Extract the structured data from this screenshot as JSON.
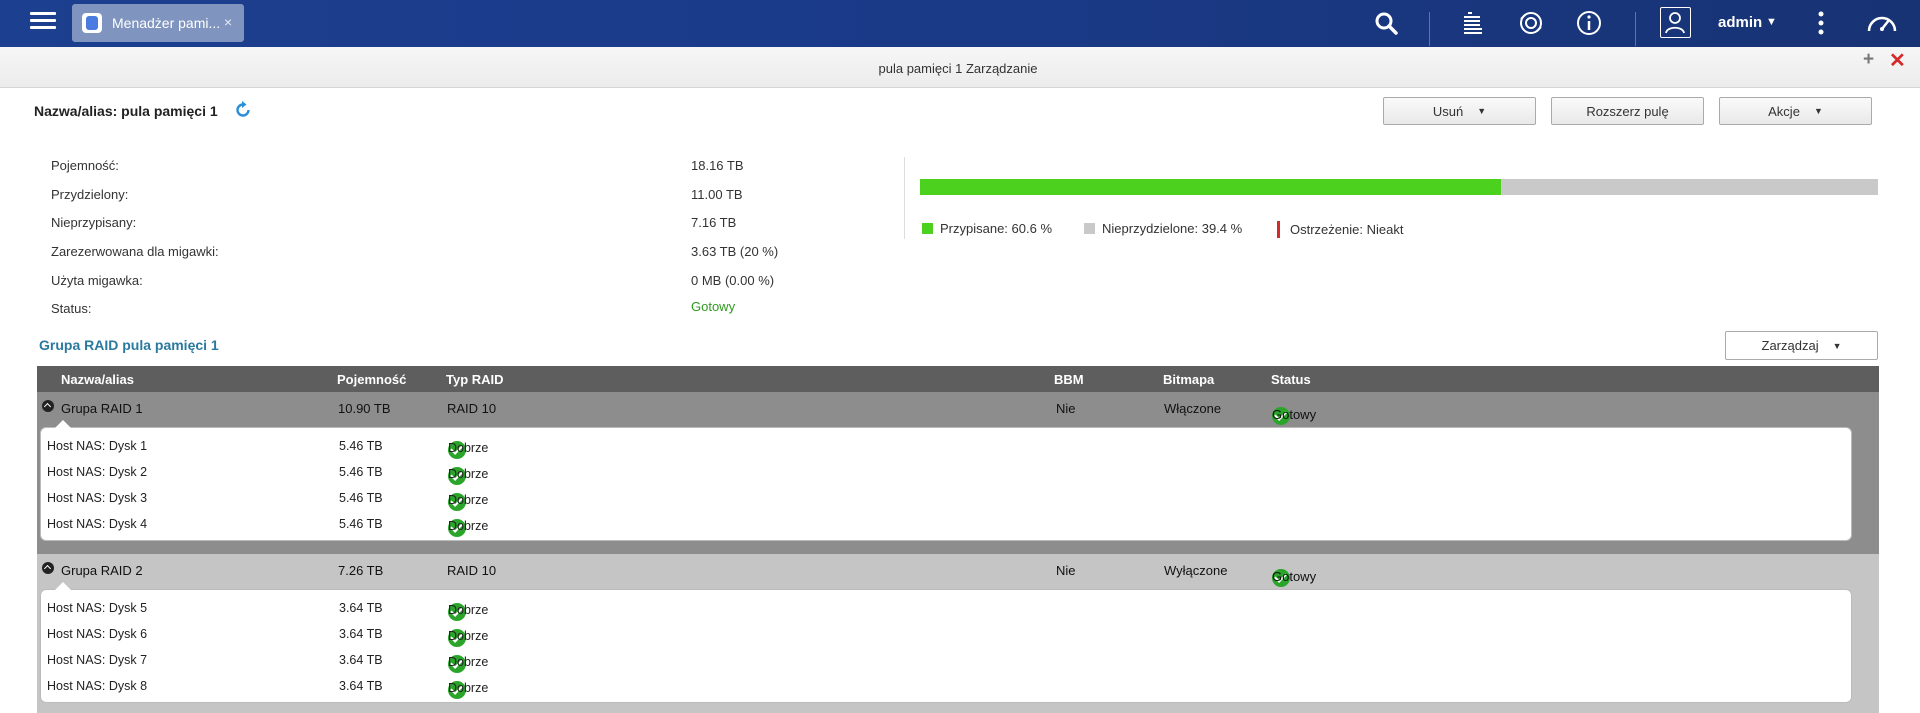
{
  "topbar": {
    "app_tab_title": "Menadżer pami...",
    "app_tab_close": "×",
    "user": "admin",
    "user_caret": "▼",
    "icons": [
      "menu-icon",
      "storage-app-icon",
      "search-icon",
      "tasks-icon",
      "sync-icon",
      "info-icon",
      "user-icon",
      "more-icon",
      "dashboard-icon"
    ]
  },
  "window": {
    "title": "pula pamięci 1 Zarządzanie",
    "plus": "+",
    "close": "✕"
  },
  "header": {
    "pool_name": "Nazwa/alias: pula pamięci 1",
    "buttons": {
      "remove": "Usuń",
      "expand": "Rozszerz pulę",
      "actions": "Akcje"
    }
  },
  "info": {
    "rows": [
      {
        "label": "Pojemność:",
        "value": "18.16 TB"
      },
      {
        "label": "Przydzielony:",
        "value": "11.00 TB"
      },
      {
        "label": "Nieprzypisany:",
        "value": "7.16 TB"
      },
      {
        "label": "Zarezerwowana dla migawki:",
        "value": "3.63 TB (20 %)"
      },
      {
        "label": "Użyta migawka:",
        "value": "0 MB (0.00 %)"
      },
      {
        "label": "Status:",
        "value": "Gotowy"
      }
    ],
    "usage_fraction": 0.606,
    "legend": {
      "assigned": "Przypisane: 60.6 %",
      "unallocated": "Nieprzydzielone: 39.4 %",
      "warning": "Ostrzeżenie: Nieakt"
    },
    "colors": {
      "assigned": "#4cd11f",
      "unallocated": "#c9c9c9",
      "warning": "#d42a2a",
      "status_ok": "#2f9a1f"
    }
  },
  "raid": {
    "title": "Grupa RAID pula pamięci 1",
    "manage_label": "Zarządzaj",
    "columns": {
      "name": "Nazwa/alias",
      "capacity": "Pojemność",
      "type": "Typ RAID",
      "bbm": "BBM",
      "bitmap": "Bitmapa",
      "status": "Status"
    },
    "groups": [
      {
        "name": "Grupa RAID 1",
        "capacity": "10.90 TB",
        "type": "RAID 10",
        "bbm": "Nie",
        "bitmap": "Włączone",
        "status": "Gotowy",
        "disks": [
          {
            "name": "Host NAS: Dysk 1",
            "capacity": "5.46 TB",
            "status": "Dobrze"
          },
          {
            "name": "Host NAS: Dysk 2",
            "capacity": "5.46 TB",
            "status": "Dobrze"
          },
          {
            "name": "Host NAS: Dysk 3",
            "capacity": "5.46 TB",
            "status": "Dobrze"
          },
          {
            "name": "Host NAS: Dysk 4",
            "capacity": "5.46 TB",
            "status": "Dobrze"
          }
        ]
      },
      {
        "name": "Grupa RAID 2",
        "capacity": "7.26 TB",
        "type": "RAID 10",
        "bbm": "Nie",
        "bitmap": "Wyłączone",
        "status": "Gotowy",
        "disks": [
          {
            "name": "Host NAS: Dysk 5",
            "capacity": "3.64 TB",
            "status": "Dobrze"
          },
          {
            "name": "Host NAS: Dysk 6",
            "capacity": "3.64 TB",
            "status": "Dobrze"
          },
          {
            "name": "Host NAS: Dysk 7",
            "capacity": "3.64 TB",
            "status": "Dobrze"
          },
          {
            "name": "Host NAS: Dysk 8",
            "capacity": "3.64 TB",
            "status": "Dobrze"
          }
        ]
      }
    ]
  }
}
